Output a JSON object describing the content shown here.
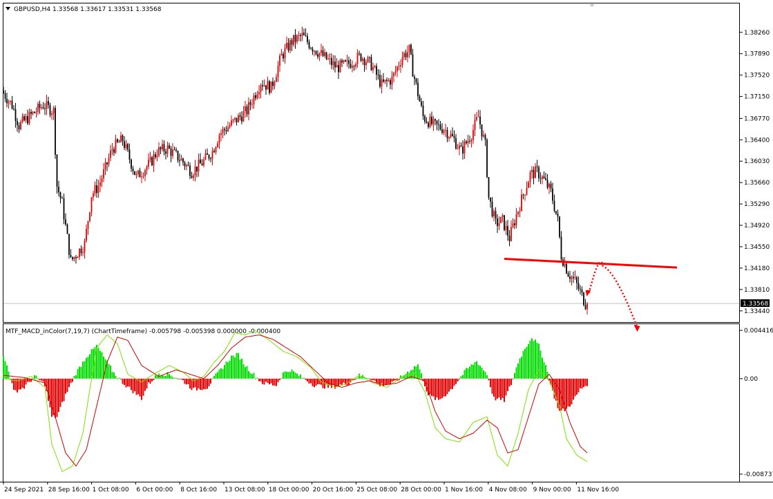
{
  "header": {
    "main_title": "GBPUSD,H4  1.33568 1.33617 1.33531 1.33568",
    "indicator_title": "MTF_MACD_inColor(7,19,7) (ChartTimeframe) -0.005798 -0.005398 0.000000 -0.000400"
  },
  "colors": {
    "background": "#ffffff",
    "bull_candle": "#e00000",
    "bear_candle": "#000000",
    "hist_positive": "#00e000",
    "hist_negative": "#f00000",
    "macd_line": "#7ee000",
    "signal_line": "#d00000",
    "support_line": "#ff0000",
    "grid_border": "#000000"
  },
  "chart_data": [
    {
      "type": "candlestick",
      "symbol": "GBPUSD",
      "timeframe": "H4",
      "last_price": "1.33568",
      "price_axis_labels": [
        "1.38260",
        "1.37890",
        "1.37520",
        "1.37150",
        "1.36770",
        "1.36400",
        "1.36030",
        "1.35660",
        "1.35290",
        "1.34920",
        "1.34550",
        "1.34180",
        "1.33810",
        "1.33440"
      ],
      "ylim": [
        1.3327,
        1.3858
      ],
      "time_axis_labels": [
        "24 Sep 2021",
        "28 Sep 16:00",
        "1 Oct 08:00",
        "6 Oct 00:00",
        "8 Oct 16:00",
        "13 Oct 08:00",
        "18 Oct 00:00",
        "20 Oct 16:00",
        "25 Oct 08:00",
        "28 Oct 00:00",
        "1 Nov 16:00",
        "4 Nov 08:00",
        "9 Nov 00:00",
        "11 Nov 16:00"
      ],
      "price_path": [
        [
          0,
          1.3725
        ],
        [
          6,
          1.37
        ],
        [
          10,
          1.3665
        ],
        [
          16,
          1.368
        ],
        [
          24,
          1.37
        ],
        [
          30,
          1.369
        ],
        [
          32,
          1.356
        ],
        [
          35,
          1.353
        ],
        [
          40,
          1.343
        ],
        [
          44,
          1.3445
        ],
        [
          48,
          1.346
        ],
        [
          52,
          1.3545
        ],
        [
          56,
          1.356
        ],
        [
          60,
          1.359
        ],
        [
          64,
          1.3625
        ],
        [
          70,
          1.364
        ],
        [
          78,
          1.3575
        ],
        [
          86,
          1.36
        ],
        [
          90,
          1.362
        ],
        [
          96,
          1.3625
        ],
        [
          104,
          1.3605
        ],
        [
          110,
          1.3585
        ],
        [
          116,
          1.36
        ],
        [
          122,
          1.362
        ],
        [
          126,
          1.365
        ],
        [
          134,
          1.367
        ],
        [
          142,
          1.369
        ],
        [
          150,
          1.374
        ],
        [
          156,
          1.373
        ],
        [
          162,
          1.3785
        ],
        [
          168,
          1.381
        ],
        [
          174,
          1.382
        ],
        [
          180,
          1.38
        ],
        [
          188,
          1.378
        ],
        [
          194,
          1.3765
        ],
        [
          200,
          1.377
        ],
        [
          208,
          1.3785
        ],
        [
          214,
          1.377
        ],
        [
          220,
          1.3735
        ],
        [
          226,
          1.3745
        ],
        [
          232,
          1.3785
        ],
        [
          236,
          1.3795
        ],
        [
          238,
          1.376
        ],
        [
          244,
          1.368
        ],
        [
          250,
          1.3665
        ],
        [
          256,
          1.366
        ],
        [
          262,
          1.364
        ],
        [
          266,
          1.362
        ],
        [
          272,
          1.365
        ],
        [
          276,
          1.368
        ],
        [
          280,
          1.363
        ],
        [
          282,
          1.354
        ],
        [
          286,
          1.3495
        ],
        [
          290,
          1.35
        ],
        [
          294,
          1.347
        ],
        [
          298,
          1.351
        ],
        [
          302,
          1.3545
        ],
        [
          306,
          1.358
        ],
        [
          310,
          1.3585
        ],
        [
          314,
          1.357
        ],
        [
          318,
          1.355
        ],
        [
          322,
          1.35
        ],
        [
          324,
          1.344
        ],
        [
          328,
          1.341
        ],
        [
          332,
          1.3395
        ],
        [
          336,
          1.337
        ],
        [
          338,
          1.33568
        ]
      ],
      "annotations": [
        {
          "type": "trendline",
          "label": "support",
          "from": [
            290,
            1.3434
          ],
          "to": [
            390,
            1.3419
          ]
        },
        {
          "type": "projected-path",
          "style": "dotted-arrow"
        }
      ]
    },
    {
      "type": "histogram+line",
      "name": "MTF_MACD_inColor(7,19,7)",
      "axis_labels": [
        "0.004416",
        "0.00",
        "-0.008737"
      ],
      "ylim": [
        -0.008737,
        0.004416
      ],
      "values": {
        "macd": "-0.005798",
        "signal": "-0.005398",
        "histogram": "0.000000",
        "other": "-0.000400"
      },
      "histogram_path": [
        [
          0,
          0.002
        ],
        [
          3,
          0.0008
        ],
        [
          6,
          -0.0012
        ],
        [
          12,
          -0.0008
        ],
        [
          18,
          0.0002
        ],
        [
          24,
          -0.0005
        ],
        [
          28,
          -0.0035
        ],
        [
          31,
          -0.0035
        ],
        [
          36,
          -0.0015
        ],
        [
          42,
          0.0005
        ],
        [
          48,
          0.002
        ],
        [
          54,
          0.003
        ],
        [
          60,
          0.0015
        ],
        [
          64,
          0.0005
        ],
        [
          70,
          -0.0005
        ],
        [
          80,
          -0.0018
        ],
        [
          84,
          -0.0005
        ],
        [
          90,
          0.0005
        ],
        [
          96,
          0.0004
        ],
        [
          104,
          -0.0002
        ],
        [
          110,
          -0.001
        ],
        [
          118,
          -0.0008
        ],
        [
          124,
          0.0005
        ],
        [
          132,
          0.002
        ],
        [
          136,
          0.0022
        ],
        [
          140,
          0.0012
        ],
        [
          146,
          0.0002
        ],
        [
          150,
          -0.0004
        ],
        [
          158,
          -0.0006
        ],
        [
          162,
          0.0005
        ],
        [
          166,
          0.0008
        ],
        [
          172,
          0.0002
        ],
        [
          180,
          -0.0006
        ],
        [
          190,
          -0.0008
        ],
        [
          200,
          -0.0004
        ],
        [
          206,
          0.0003
        ],
        [
          212,
          0.0001
        ],
        [
          218,
          -0.0006
        ],
        [
          226,
          -0.0004
        ],
        [
          234,
          0.0006
        ],
        [
          240,
          0.0013
        ],
        [
          246,
          -0.0015
        ],
        [
          252,
          -0.002
        ],
        [
          258,
          -0.0012
        ],
        [
          264,
          0.0
        ],
        [
          268,
          0.0008
        ],
        [
          274,
          0.0016
        ],
        [
          280,
          0.0004
        ],
        [
          284,
          -0.0018
        ],
        [
          290,
          -0.002
        ],
        [
          294,
          -0.0005
        ],
        [
          298,
          0.0015
        ],
        [
          302,
          0.0028
        ],
        [
          306,
          0.0038
        ],
        [
          310,
          0.003
        ],
        [
          314,
          0.0012
        ],
        [
          318,
          -0.0012
        ],
        [
          322,
          -0.003
        ],
        [
          326,
          -0.0028
        ],
        [
          330,
          -0.002
        ],
        [
          334,
          -0.001
        ],
        [
          338,
          -0.0005
        ]
      ],
      "macd_path": [
        [
          0,
          0.0
        ],
        [
          8,
          -0.0002
        ],
        [
          16,
          0.0002
        ],
        [
          24,
          -0.0008
        ],
        [
          28,
          -0.006
        ],
        [
          34,
          -0.0085
        ],
        [
          40,
          -0.008
        ],
        [
          46,
          -0.005
        ],
        [
          50,
          -0.001
        ],
        [
          54,
          0.0028
        ],
        [
          60,
          0.004
        ],
        [
          66,
          0.0032
        ],
        [
          72,
          0.0004
        ],
        [
          80,
          -0.0003
        ],
        [
          88,
          0.0005
        ],
        [
          96,
          0.0012
        ],
        [
          104,
          0.0006
        ],
        [
          110,
          -0.0002
        ],
        [
          116,
          0.0002
        ],
        [
          122,
          0.0015
        ],
        [
          128,
          0.0025
        ],
        [
          134,
          0.0042
        ],
        [
          140,
          0.004
        ],
        [
          146,
          0.0044
        ],
        [
          154,
          0.0035
        ],
        [
          162,
          0.0025
        ],
        [
          170,
          0.002
        ],
        [
          178,
          0.001
        ],
        [
          184,
          -0.0003
        ],
        [
          192,
          -0.0008
        ],
        [
          198,
          -0.0005
        ],
        [
          206,
          0.0003
        ],
        [
          214,
          -0.0004
        ],
        [
          222,
          -0.0008
        ],
        [
          230,
          0.0001
        ],
        [
          238,
          0.0005
        ],
        [
          244,
          -0.0012
        ],
        [
          250,
          -0.0045
        ],
        [
          256,
          -0.0055
        ],
        [
          264,
          -0.0058
        ],
        [
          272,
          -0.004
        ],
        [
          280,
          -0.0035
        ],
        [
          286,
          -0.007
        ],
        [
          292,
          -0.008
        ],
        [
          298,
          -0.005
        ],
        [
          304,
          -0.001
        ],
        [
          310,
          0.0008
        ],
        [
          316,
          -0.0002
        ],
        [
          322,
          -0.0025
        ],
        [
          326,
          -0.0055
        ],
        [
          332,
          -0.007
        ],
        [
          338,
          -0.0076
        ]
      ],
      "signal_path": [
        [
          0,
          0.0003
        ],
        [
          12,
          0.0001
        ],
        [
          24,
          -0.0004
        ],
        [
          30,
          -0.0035
        ],
        [
          36,
          -0.0068
        ],
        [
          42,
          -0.008
        ],
        [
          48,
          -0.0065
        ],
        [
          54,
          -0.0025
        ],
        [
          60,
          0.0015
        ],
        [
          66,
          0.0038
        ],
        [
          72,
          0.0035
        ],
        [
          80,
          0.0012
        ],
        [
          90,
          0.0002
        ],
        [
          100,
          0.0008
        ],
        [
          108,
          0.0004
        ],
        [
          116,
          0.0
        ],
        [
          124,
          0.0012
        ],
        [
          132,
          0.0028
        ],
        [
          140,
          0.0038
        ],
        [
          148,
          0.004
        ],
        [
          156,
          0.0036
        ],
        [
          164,
          0.0028
        ],
        [
          172,
          0.002
        ],
        [
          180,
          0.0008
        ],
        [
          188,
          -0.0004
        ],
        [
          196,
          -0.0008
        ],
        [
          204,
          -0.0004
        ],
        [
          212,
          -0.0002
        ],
        [
          220,
          -0.0006
        ],
        [
          228,
          -0.0004
        ],
        [
          236,
          0.0002
        ],
        [
          244,
          -0.0002
        ],
        [
          250,
          -0.003
        ],
        [
          256,
          -0.0048
        ],
        [
          264,
          -0.0055
        ],
        [
          272,
          -0.005
        ],
        [
          280,
          -0.0038
        ],
        [
          286,
          -0.0045
        ],
        [
          292,
          -0.0068
        ],
        [
          298,
          -0.0065
        ],
        [
          304,
          -0.0035
        ],
        [
          310,
          -0.0005
        ],
        [
          316,
          0.0004
        ],
        [
          322,
          -0.001
        ],
        [
          328,
          -0.004
        ],
        [
          334,
          -0.0062
        ],
        [
          338,
          -0.0068
        ]
      ]
    }
  ]
}
